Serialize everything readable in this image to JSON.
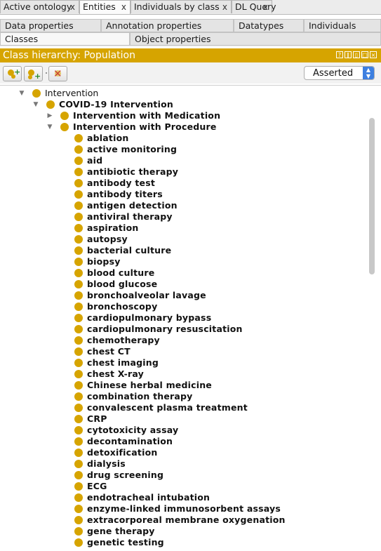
{
  "top_tabs": [
    {
      "label": "Active ontology",
      "close": "x",
      "active": false
    },
    {
      "label": "Entities",
      "close": "x",
      "active": true
    },
    {
      "label": "Individuals by class",
      "close": "x",
      "active": false
    },
    {
      "label": "DL Query",
      "close": "x",
      "active": false
    }
  ],
  "sub_tabs_row1": [
    "Data properties",
    "Annotation properties",
    "Datatypes",
    "Individuals"
  ],
  "sub_tabs_row2": [
    "Classes",
    "Object properties"
  ],
  "header": {
    "title": "Class hierarchy: Population",
    "color": "#d6a400"
  },
  "toolbar": {
    "view_mode": "Asserted"
  },
  "tree": {
    "root": "Intervention",
    "child": "COVID-19 Intervention",
    "groups": [
      {
        "label": "Intervention with Medication",
        "expanded": false
      },
      {
        "label": "Intervention with Procedure",
        "expanded": true
      }
    ],
    "procedures": [
      "ablation",
      "active monitoring",
      "aid",
      "antibiotic therapy",
      "antibody test",
      "antibody titers",
      "antigen detection",
      "antiviral therapy",
      "aspiration",
      "autopsy",
      "bacterial culture",
      "biopsy",
      "blood culture",
      "blood glucose",
      "bronchoalveolar lavage",
      "bronchoscopy",
      "cardiopulmonary bypass",
      "cardiopulmonary resuscitation",
      "chemotherapy",
      "chest CT",
      "chest imaging",
      "chest X-ray",
      "Chinese herbal medicine",
      "combination therapy",
      "convalescent plasma treatment",
      "CRP",
      "cytotoxicity assay",
      "decontamination",
      "detoxification",
      "dialysis",
      "drug screening",
      "ECG",
      "endotracheal intubation",
      "enzyme-linked immunosorbent assays",
      "extracorporeal membrane oxygenation",
      "gene therapy",
      "genetic testing"
    ]
  },
  "colors": {
    "class_dot": "#d6a400",
    "accent": "#3d7fe0"
  }
}
